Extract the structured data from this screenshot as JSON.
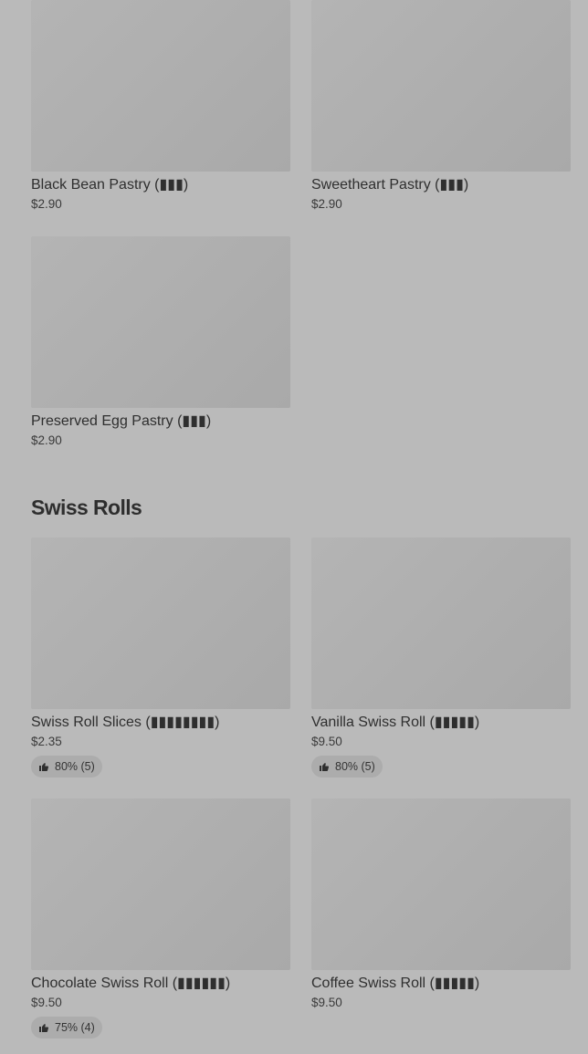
{
  "pastries": {
    "items": [
      {
        "title": "Black Bean Pastry (▮▮▮)",
        "price": "$2.90"
      },
      {
        "title": "Sweetheart Pastry (▮▮▮)",
        "price": "$2.90"
      },
      {
        "title": "Preserved Egg Pastry (▮▮▮)",
        "price": "$2.90"
      }
    ]
  },
  "swiss_rolls": {
    "heading": "Swiss Rolls",
    "items": [
      {
        "title": "Swiss Roll Slices (▮▮▮▮▮▮▮▮)",
        "price": "$2.35",
        "rating": "80% (5)"
      },
      {
        "title": "Vanilla Swiss Roll (▮▮▮▮▮)",
        "price": "$9.50",
        "rating": "80% (5)"
      },
      {
        "title": "Chocolate Swiss Roll (▮▮▮▮▮▮)",
        "price": "$9.50",
        "rating": "75% (4)"
      },
      {
        "title": "Coffee Swiss Roll (▮▮▮▮▮)",
        "price": "$9.50"
      }
    ]
  },
  "icons": {
    "rating_icon": "thumbs-up-icon"
  }
}
